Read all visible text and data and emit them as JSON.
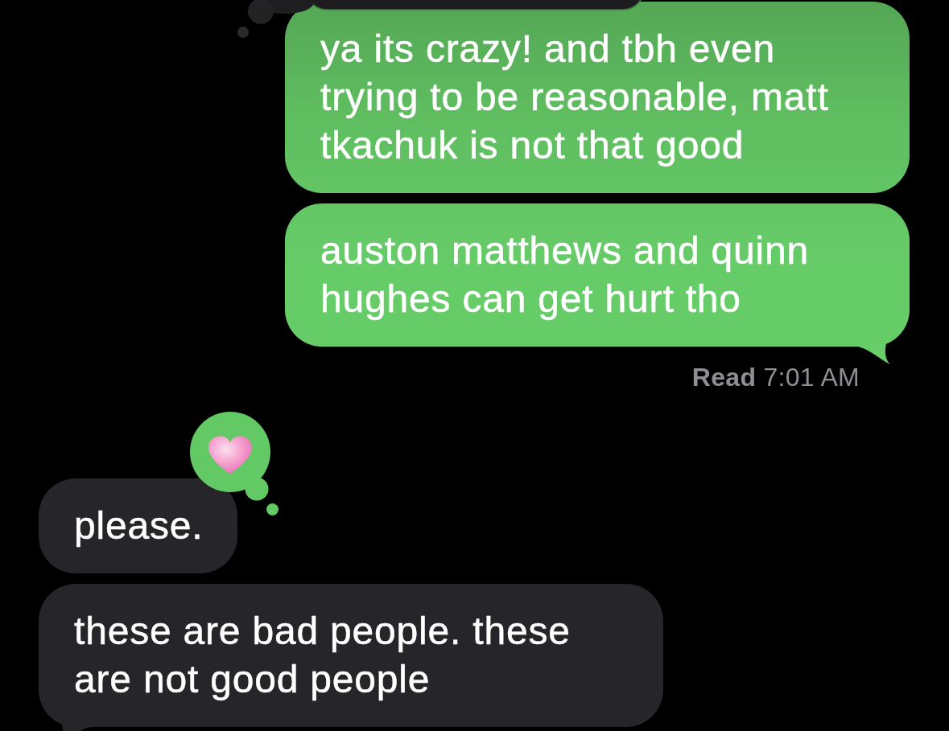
{
  "items": [
    {
      "kind": "sent",
      "text": "ya its crazy! and tbh even trying to be reasonable, matt tkachuk is not that good",
      "reacted": true,
      "tail": false
    },
    {
      "kind": "sent",
      "text": "auston matthews and quinn hughes can get hurt tho",
      "reacted": false,
      "tail": true
    },
    {
      "kind": "receipt",
      "text": "**Read** 7:01 AM"
    },
    {
      "kind": "received",
      "text": "please.",
      "reacted": true,
      "tail": false
    },
    {
      "kind": "received",
      "text": "these are bad people. these are not good people",
      "reacted": false,
      "tail": true
    }
  ]
}
